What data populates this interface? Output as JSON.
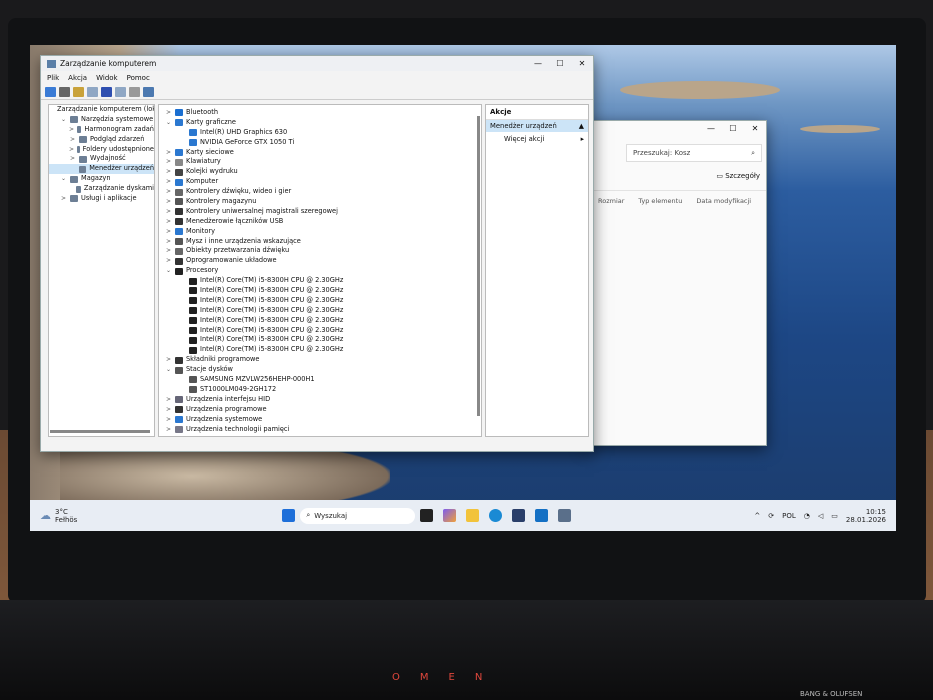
{
  "main_window": {
    "title": "Zarządzanie komputerem",
    "menu": [
      "Plik",
      "Akcja",
      "Widok",
      "Pomoc"
    ],
    "tree": [
      {
        "label": "Zarządzanie komputerem (lokal",
        "lvl": 0,
        "chev": ""
      },
      {
        "label": "Narzędzia systemowe",
        "lvl": 1,
        "chev": "v"
      },
      {
        "label": "Harmonogram zadań",
        "lvl": 2,
        "chev": ">"
      },
      {
        "label": "Podgląd zdarzeń",
        "lvl": 2,
        "chev": ">"
      },
      {
        "label": "Foldery udostępnione",
        "lvl": 2,
        "chev": ">"
      },
      {
        "label": "Wydajność",
        "lvl": 2,
        "chev": ">"
      },
      {
        "label": "Menedżer urządzeń",
        "lvl": 2,
        "chev": "",
        "selected": true
      },
      {
        "label": "Magazyn",
        "lvl": 1,
        "chev": "v"
      },
      {
        "label": "Zarządzanie dyskami",
        "lvl": 2,
        "chev": ""
      },
      {
        "label": "Usługi i aplikacje",
        "lvl": 1,
        "chev": ">"
      }
    ],
    "devices": [
      {
        "label": "Bluetooth",
        "lvl": 0,
        "chev": ">",
        "icon": "bluetooth"
      },
      {
        "label": "Karty graficzne",
        "lvl": 0,
        "chev": "v",
        "icon": "display"
      },
      {
        "label": "Intel(R) UHD Graphics 630",
        "lvl": 1,
        "chev": "",
        "icon": "display"
      },
      {
        "label": "NVIDIA GeForce GTX 1050 Ti",
        "lvl": 1,
        "chev": "",
        "icon": "display"
      },
      {
        "label": "Karty sieciowe",
        "lvl": 0,
        "chev": ">",
        "icon": "network"
      },
      {
        "label": "Klawiatury",
        "lvl": 0,
        "chev": ">",
        "icon": "keyboard"
      },
      {
        "label": "Kolejki wydruku",
        "lvl": 0,
        "chev": ">",
        "icon": "printer"
      },
      {
        "label": "Komputer",
        "lvl": 0,
        "chev": ">",
        "icon": "display"
      },
      {
        "label": "Kontrolery dźwięku, wideo i gier",
        "lvl": 0,
        "chev": ">",
        "icon": "audio"
      },
      {
        "label": "Kontrolery magazynu",
        "lvl": 0,
        "chev": ">",
        "icon": "storage"
      },
      {
        "label": "Kontrolery uniwersalnej magistrali szeregowej",
        "lvl": 0,
        "chev": ">",
        "icon": "usb"
      },
      {
        "label": "Menedżerowie łączników USB",
        "lvl": 0,
        "chev": ">",
        "icon": "usb"
      },
      {
        "label": "Monitory",
        "lvl": 0,
        "chev": ">",
        "icon": "display"
      },
      {
        "label": "Mysz i inne urządzenia wskazujące",
        "lvl": 0,
        "chev": ">",
        "icon": "mouse"
      },
      {
        "label": "Obiekty przetwarzania dźwięku",
        "lvl": 0,
        "chev": ">",
        "icon": "audio"
      },
      {
        "label": "Oprogramowanie układowe",
        "lvl": 0,
        "chev": ">",
        "icon": "chip"
      },
      {
        "label": "Procesory",
        "lvl": 0,
        "chev": "v",
        "icon": "cpu"
      },
      {
        "label": "Intel(R) Core(TM) i5-8300H CPU @ 2.30GHz",
        "lvl": 1,
        "chev": "",
        "icon": "cpu"
      },
      {
        "label": "Intel(R) Core(TM) i5-8300H CPU @ 2.30GHz",
        "lvl": 1,
        "chev": "",
        "icon": "cpu"
      },
      {
        "label": "Intel(R) Core(TM) i5-8300H CPU @ 2.30GHz",
        "lvl": 1,
        "chev": "",
        "icon": "cpu"
      },
      {
        "label": "Intel(R) Core(TM) i5-8300H CPU @ 2.30GHz",
        "lvl": 1,
        "chev": "",
        "icon": "cpu"
      },
      {
        "label": "Intel(R) Core(TM) i5-8300H CPU @ 2.30GHz",
        "lvl": 1,
        "chev": "",
        "icon": "cpu"
      },
      {
        "label": "Intel(R) Core(TM) i5-8300H CPU @ 2.30GHz",
        "lvl": 1,
        "chev": "",
        "icon": "cpu"
      },
      {
        "label": "Intel(R) Core(TM) i5-8300H CPU @ 2.30GHz",
        "lvl": 1,
        "chev": "",
        "icon": "cpu"
      },
      {
        "label": "Intel(R) Core(TM) i5-8300H CPU @ 2.30GHz",
        "lvl": 1,
        "chev": "",
        "icon": "cpu"
      },
      {
        "label": "Składniki programowe",
        "lvl": 0,
        "chev": ">",
        "icon": "chip"
      },
      {
        "label": "Stacje dysków",
        "lvl": 0,
        "chev": "v",
        "icon": "disk"
      },
      {
        "label": "SAMSUNG MZVLW256HEHP-000H1",
        "lvl": 1,
        "chev": "",
        "icon": "disk"
      },
      {
        "label": "ST1000LM049-2GH172",
        "lvl": 1,
        "chev": "",
        "icon": "disk"
      },
      {
        "label": "Urządzenia interfejsu HID",
        "lvl": 0,
        "chev": ">",
        "icon": "hid"
      },
      {
        "label": "Urządzenia programowe",
        "lvl": 0,
        "chev": ">",
        "icon": "chip"
      },
      {
        "label": "Urządzenia systemowe",
        "lvl": 0,
        "chev": ">",
        "icon": "system"
      },
      {
        "label": "Urządzenia technologii pamięci",
        "lvl": 0,
        "chev": ">",
        "icon": "memory"
      }
    ],
    "actions": {
      "header": "Akcje",
      "section": "Menedżer urządzeń",
      "more": "Więcej akcji"
    }
  },
  "explorer": {
    "search": "Przeszukaj: Kosz",
    "details": "Szczegóły",
    "columns": [
      "Rozmiar",
      "Typ elementu",
      "Data modyfikacji"
    ]
  },
  "taskbar": {
    "weather_temp": "3°C",
    "weather_desc": "Fełhös",
    "search": "Wyszukaj",
    "lang": "POL",
    "time": "10:15",
    "date": "28.01.2026"
  },
  "hardware": {
    "brand": "OMEN",
    "audio": "BANG & OLUFSEN"
  },
  "colors": {
    "accent": "#0067c0",
    "selection": "#cce4f7",
    "icon_blue": "#2b78d0"
  }
}
